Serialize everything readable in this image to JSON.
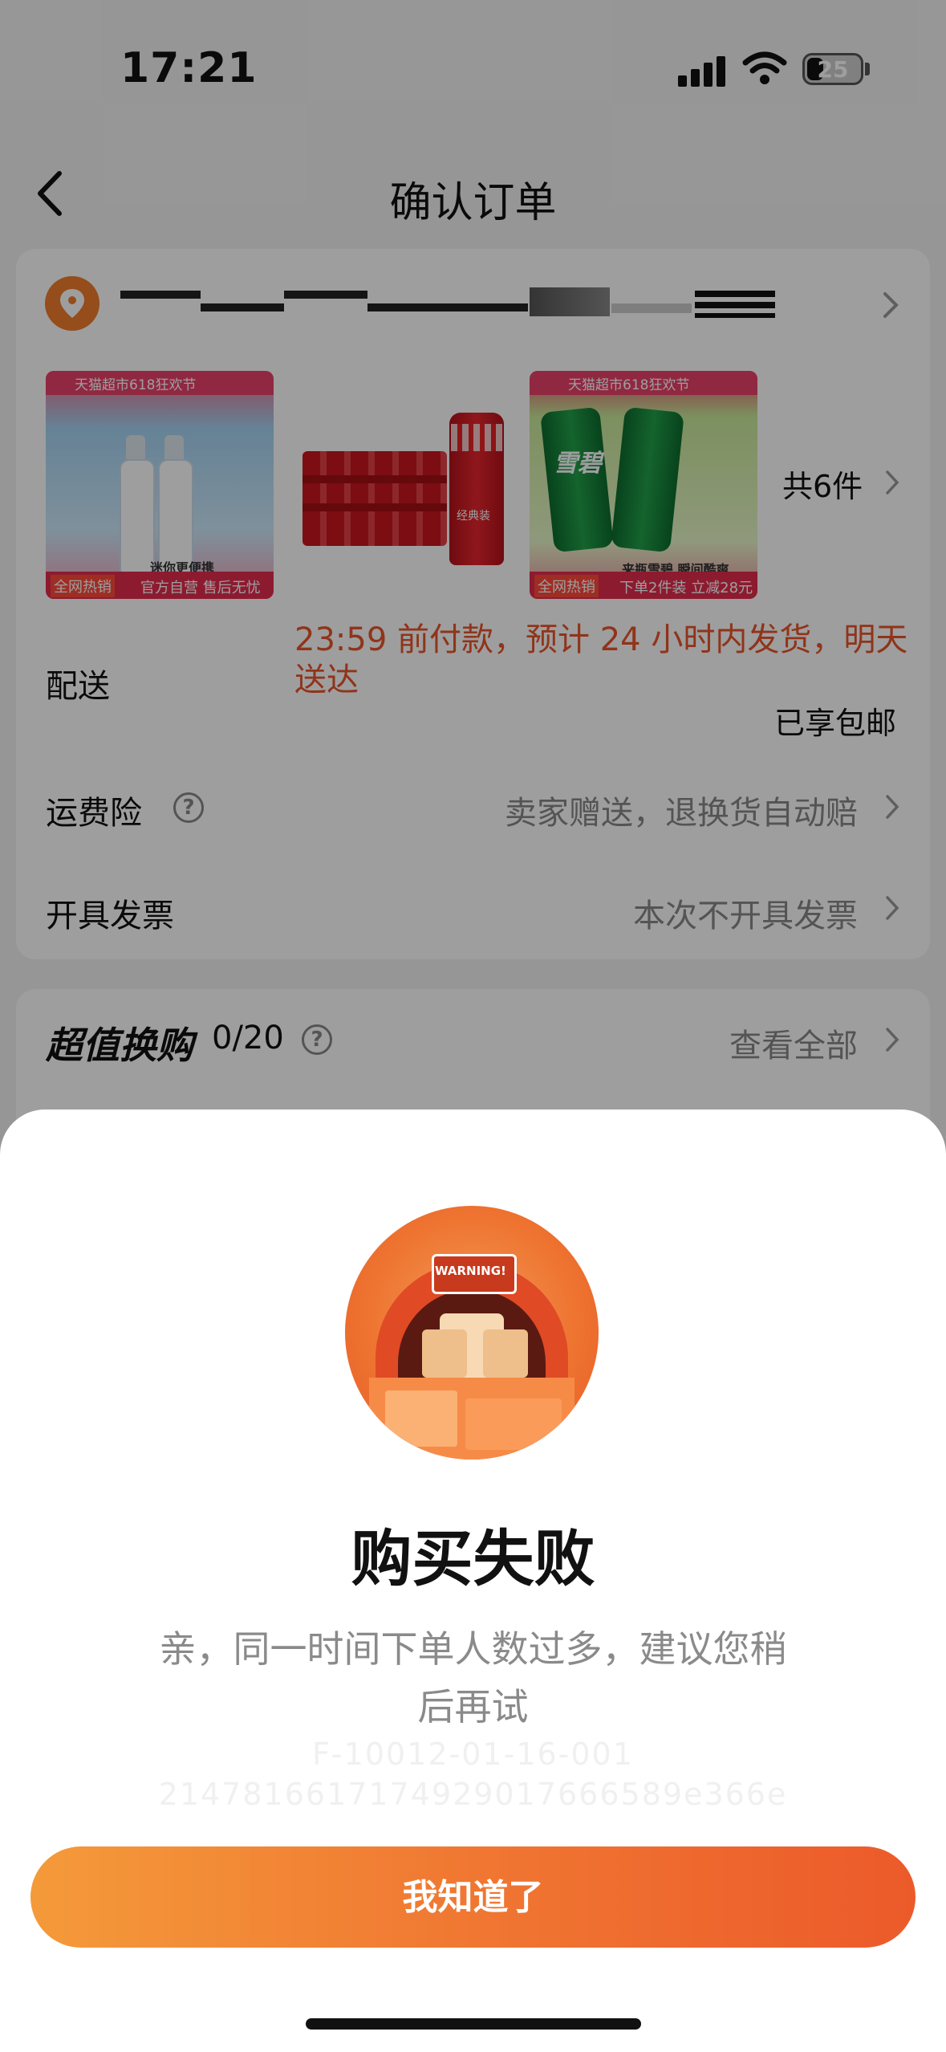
{
  "status_bar": {
    "time": "17:21",
    "battery": "25"
  },
  "nav": {
    "title": "确认订单"
  },
  "order": {
    "item_count": "共6件",
    "products": [
      {
        "banner": "天猫超市618狂欢节",
        "tag1": "全网热销",
        "tag2": "官方自营 售后无忧",
        "slogan": "迷你更便携"
      },
      {
        "label": "经典装"
      },
      {
        "banner": "天猫超市618狂欢节",
        "tag1": "全网热销",
        "tag2": "下单2件装 立减28元",
        "slogan": "来瓶雪碧 瞬间酷爽",
        "brand": "雪碧"
      }
    ],
    "delivery": {
      "label": "配送",
      "text": "23:59 前付款，预计 24 小时内发货，明天送达",
      "free_shipping": "已享包邮"
    },
    "shipping_insurance": {
      "label": "运费险",
      "value": "卖家赠送，退换货自动赔"
    },
    "invoice": {
      "label": "开具发票",
      "value": "本次不开具发票"
    }
  },
  "super_value": {
    "title": "超值换购",
    "count": "0/20",
    "view_all": "查看全部"
  },
  "dialog": {
    "warning_sign": "WARNING!",
    "title": "购买失败",
    "message": "亲，同一时间下单人数过多，建议您稍后再试",
    "code_line1": "F-10012-01-16-001",
    "code_line2": "2147816617174929017666589e366e",
    "confirm_label": "我知道了"
  },
  "colors": {
    "accent": "#ef7d2c",
    "delivery_text": "#e8552a",
    "button_start": "#f49a3a",
    "button_end": "#ec5a2a"
  }
}
